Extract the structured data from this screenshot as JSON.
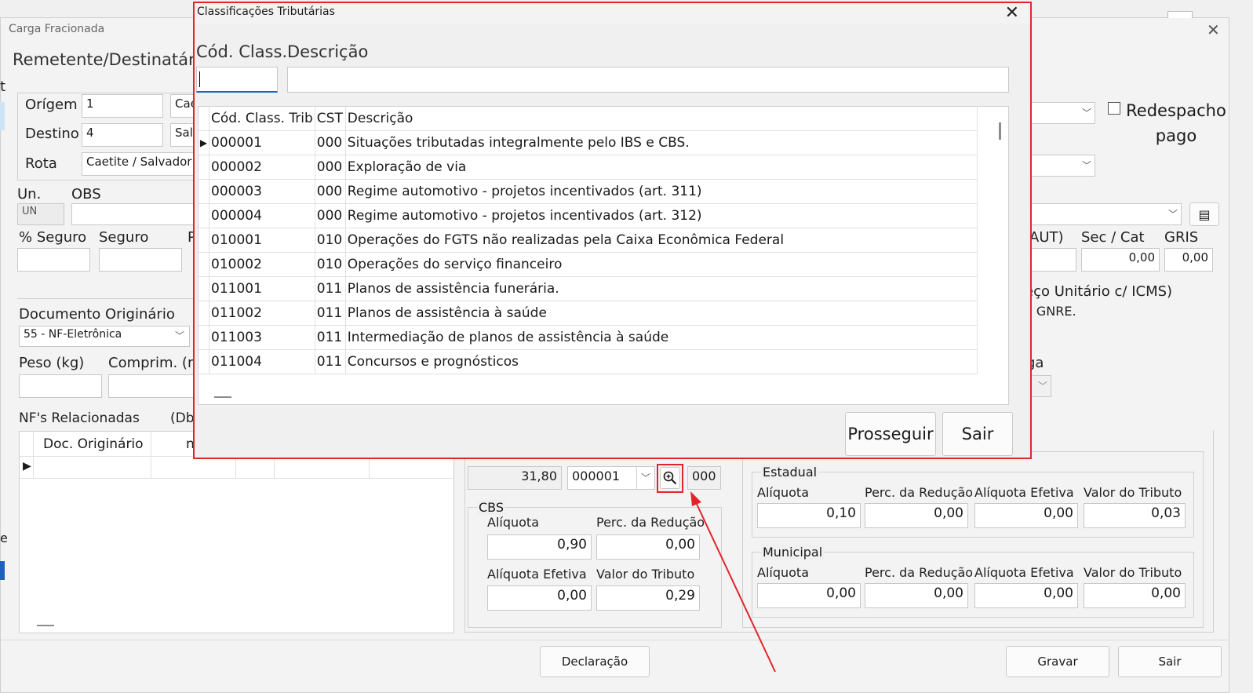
{
  "background": {
    "window_title": "Carga Fracionada",
    "section_title": "Remetente/Destinatário",
    "origem_label": "Orígem",
    "origem_value": "1",
    "origem_city": "Cae",
    "destino_label": "Destino",
    "destino_value": "4",
    "destino_city": "Salv",
    "rota_label": "Rota",
    "rota_value": "Caetite / Salvador",
    "un_label": "Un.",
    "un_value": "UN",
    "obs_label": "OBS",
    "seguro_pct_label": "% Seguro",
    "seguro_label": "Seguro",
    "p_label": "P",
    "aut_label": "AUT)",
    "sec_cat_label": "Sec / Cat",
    "sec_cat_value": "0,00",
    "gris_label": "GRIS",
    "gris_value": "0,00",
    "redespacho_label": "Redespacho pago",
    "preco_unit_text": "eço Unitário c/ ICMS)",
    "gnre_text": "a GNRE.",
    "ga_label": "ga",
    "doc_orig_label": "Documento Originário",
    "doc_orig_value": "55 - NF-Eletrônica",
    "peso_label": "Peso (kg)",
    "comprim_label": "Comprim. (m",
    "nfs_label": "NF's Relacionadas",
    "db_label": "(Db",
    "nf_col_doc": "Doc. Originário",
    "nf_col_n": "n",
    "ibs_value": "31,80",
    "class_trib_value": "000001",
    "cst_value": "000",
    "cbs": {
      "legend": "CBS",
      "aliquota_label": "Alíquota",
      "aliquota_value": "0,90",
      "perc_reducao_label": "Perc. da Redução",
      "perc_reducao_value": "0,00",
      "aliquota_efetiva_label": "Alíquota Efetiva",
      "aliquota_efetiva_value": "0,00",
      "valor_tributo_label": "Valor do Tributo",
      "valor_tributo_value": "0,29"
    },
    "estadual": {
      "legend": "Estadual",
      "aliquota_label": "Alíquota",
      "aliquota_value": "0,10",
      "perc_reducao_label": "Perc. da Redução",
      "perc_reducao_value": "0,00",
      "aliquota_efetiva_label": "Alíquota Efetiva",
      "aliquota_efetiva_value": "0,00",
      "valor_tributo_label": "Valor do Tributo",
      "valor_tributo_value": "0,03"
    },
    "municipal": {
      "legend": "Municipal",
      "aliquota_label": "Alíquota",
      "aliquota_value": "0,00",
      "perc_reducao_label": "Perc. da Redução",
      "perc_reducao_value": "0,00",
      "aliquota_efetiva_label": "Alíquota Efetiva",
      "aliquota_efetiva_value": "0,00",
      "valor_tributo_label": "Valor do Tributo",
      "valor_tributo_value": "0,00"
    },
    "declaracao_label": "Declaração",
    "gravar_label": "Gravar",
    "sair_label": "Sair"
  },
  "modal": {
    "title": "Classificações Tributárias",
    "cod_class_label": "Cód. Class.",
    "descricao_label": "Descrição",
    "cod_class_value": "",
    "descricao_value": "",
    "columns": [
      "Cód. Class. Trib",
      "CST",
      "Descrição"
    ],
    "rows": [
      {
        "cod": "000001",
        "cst": "000",
        "desc": "Situações tributadas integralmente pelo IBS e CBS."
      },
      {
        "cod": "000002",
        "cst": "000",
        "desc": "Exploração de via"
      },
      {
        "cod": "000003",
        "cst": "000",
        "desc": "Regime automotivo - projetos incentivados (art. 311)"
      },
      {
        "cod": "000004",
        "cst": "000",
        "desc": "Regime automotivo - projetos incentivados (art. 312)"
      },
      {
        "cod": "010001",
        "cst": "010",
        "desc": "Operações do FGTS não realizadas pela Caixa Econômica Federal"
      },
      {
        "cod": "010002",
        "cst": "010",
        "desc": "Operações do serviço financeiro"
      },
      {
        "cod": "011001",
        "cst": "011",
        "desc": "Planos de assistência funerária."
      },
      {
        "cod": "011002",
        "cst": "011",
        "desc": "Planos de assistência à saúde"
      },
      {
        "cod": "011003",
        "cst": "011",
        "desc": "Intermediação de planos de assistência à saúde"
      },
      {
        "cod": "011004",
        "cst": "011",
        "desc": "Concursos e prognósticos"
      }
    ],
    "prosseguir_label": "Prosseguir",
    "sair_label": "Sair"
  },
  "colors": {
    "highlight_red": "#e0262b",
    "accent_blue": "#1f5fbf"
  }
}
